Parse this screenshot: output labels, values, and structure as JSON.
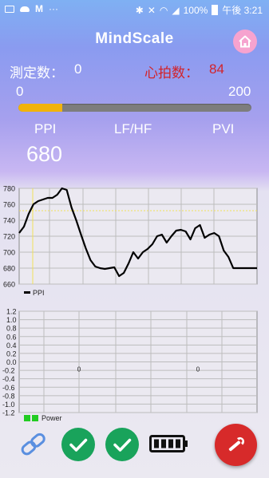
{
  "status_bar": {
    "battery": "100%",
    "time": "午後 3:21",
    "ellipsis": "···"
  },
  "app": {
    "title": "MindScale"
  },
  "counts": {
    "measure_label": "測定数：",
    "measure_value": "0",
    "heart_label": "心拍数：",
    "heart_value": "84",
    "heart_color": "#d2232a"
  },
  "progress": {
    "min": "0",
    "max": "200",
    "value_fraction": 0.19,
    "fill_color": "#f1b30b"
  },
  "metrics": {
    "ppi_label": "PPI",
    "lfhf_label": "LF/HF",
    "pvi_label": "PVI",
    "ppi_value": "680"
  },
  "chart_data": [
    {
      "type": "line",
      "legend": [
        "PPI"
      ],
      "ylim": [
        660,
        780
      ],
      "yticks": [
        "780",
        "760",
        "740",
        "720",
        "700",
        "680",
        "660"
      ],
      "grid": true,
      "series": [
        {
          "name": "PPI",
          "x": [
            0,
            1,
            2,
            3,
            4,
            5,
            6,
            7,
            8,
            9,
            10,
            11,
            12,
            13,
            14,
            15,
            16,
            17,
            18,
            19,
            20,
            21,
            22,
            23,
            24,
            25,
            26,
            27,
            28,
            29,
            30,
            31,
            32,
            33,
            34,
            35,
            36,
            37,
            38,
            39,
            40,
            41,
            42,
            43,
            44,
            45,
            46,
            47,
            48,
            49,
            50
          ],
          "values": [
            724,
            732,
            748,
            760,
            764,
            766,
            768,
            768,
            772,
            780,
            778,
            756,
            740,
            722,
            705,
            690,
            682,
            680,
            679,
            680,
            681,
            670,
            674,
            686,
            700,
            692,
            700,
            704,
            710,
            720,
            722,
            712,
            720,
            727,
            728,
            726,
            716,
            730,
            734,
            718,
            722,
            724,
            720,
            702,
            694,
            680,
            680,
            680,
            680,
            680,
            680
          ]
        }
      ],
      "cursor_line_color": "#f1e15a"
    },
    {
      "type": "bar",
      "legend": [
        "Power"
      ],
      "ylim": [
        -1.2,
        1.2
      ],
      "yticks": [
        "1.2",
        "1.0",
        "0.8",
        "0.6",
        "0.4",
        "0.2",
        "0.0",
        "-0.2",
        "-0.4",
        "-0.6",
        "-0.8",
        "-1.0",
        "-1.2"
      ],
      "categories": [
        "",
        ""
      ],
      "values": [
        0,
        0
      ],
      "data_labels": [
        "0",
        "0"
      ],
      "grid": true
    }
  ],
  "bottom_bar": {
    "link_icon": "link-icon",
    "check1_icon": "check-icon",
    "check2_icon": "check-icon",
    "battery_icon": "battery-full-icon",
    "settings_icon": "wrench-icon",
    "check_color": "#19a35b",
    "settings_color": "#d72a2a"
  }
}
